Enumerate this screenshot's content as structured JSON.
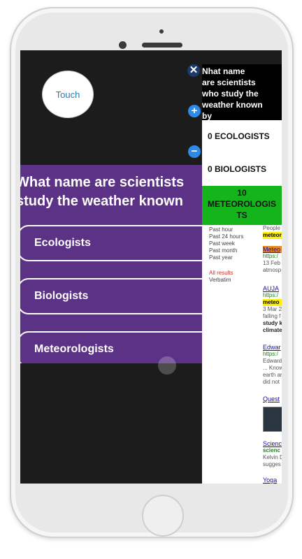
{
  "app": {
    "logo_text": "Touch"
  },
  "quiz": {
    "question_line1": "What name are scientists",
    "question_line2": "study the weather known",
    "answers": [
      "Ecologists",
      "Biologists",
      "Meteorologists"
    ]
  },
  "overlay": {
    "controls": {
      "close": "✕",
      "plus": "+",
      "minus": "−"
    },
    "question_lines": [
      "Nhat name",
      "are scientists",
      "who study the",
      "weather known",
      "by"
    ],
    "options": [
      {
        "label": "0  ECOLOGISTS"
      },
      {
        "label": "0  BIOLOGISTS"
      },
      {
        "label_line1": "10",
        "label_line2": "METEOROLOGIS",
        "label_line3": "TS",
        "correct": true
      }
    ],
    "correct_color": "#13b51a"
  },
  "search": {
    "time_filters": [
      "Past hour",
      "Past 24 hours",
      "Past week",
      "Past month",
      "Past year"
    ],
    "all_results": "All results",
    "verbatim": "Verbatim",
    "snippets": {
      "s1_a": "People",
      "s1_b": "meteor",
      "s2_title": "Meteo",
      "s2_url": "https:/",
      "s2_date": "13 Feb",
      "s2_text": "atmosp",
      "s3_title": "AUJA",
      "s3_url": "https:/",
      "s3_hl": "meteo",
      "s3_a": "3 Mar 2",
      "s3_b": "falling f",
      "s3_c": "study k",
      "s3_d": "climate",
      "s4_title": "Edwar",
      "s4_url": "https:/",
      "s4_a": "Edward",
      "s4_b": "... Know",
      "s4_c": "earth ar",
      "s4_d": "did not",
      "s5_title": "Quest",
      "s6_title": "Scienc",
      "s6_url": "scienc",
      "s6_a": "Kelvin D",
      "s6_b": "sugges",
      "s7_title": "Yoga"
    }
  }
}
